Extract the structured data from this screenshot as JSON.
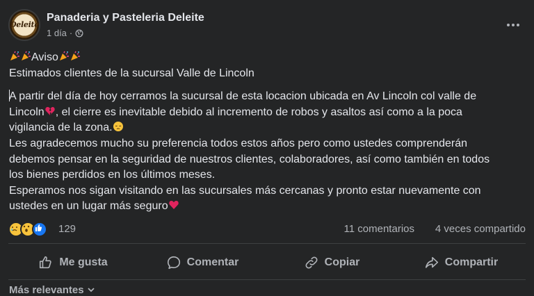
{
  "header": {
    "page_name": "Panaderia y Pasteleria Deleite",
    "logo_text": "Deleite",
    "time": "1 día",
    "separator": "·"
  },
  "post": {
    "aviso": "Aviso",
    "line1": "Estimados clientes de la sucursal Valle de Lincoln",
    "line2": "A partir del día de hoy cerramos la sucursal de esta locacion ubicada en Av Lincoln col valle de",
    "line3a": "Lincoln",
    "line3b": ", el cierre es inevitable debido al  incremento de robos y asaltos así como a la poca",
    "line4": "vigilancia de la zona.",
    "line5": "Les agradecemos mucho su preferencia todos estos años pero como ustedes comprenderán",
    "line6": "debemos pensar en la seguridad de nuestros clientes, colaboradores, así como también en todos",
    "line7": "los bienes perdidos en los últimos meses.",
    "line8": "Esperamos nos sigan visitando en las sucursales más cercanas y pronto estar nuevamente con",
    "line9": "ustedes en un lugar más seguro"
  },
  "stats": {
    "reaction_count": "129",
    "comments": "11 comentarios",
    "shares": "4 veces compartido"
  },
  "actions": {
    "like": "Me gusta",
    "comment": "Comentar",
    "copy": "Copiar",
    "share": "Compartir"
  },
  "footer": {
    "sort_label": "Más relevantes"
  },
  "colors": {
    "background": "#242526",
    "text": "#e4e6eb",
    "secondary": "#b0b3b8",
    "like_blue": "#1877f2",
    "heart_red": "#e0245e"
  }
}
